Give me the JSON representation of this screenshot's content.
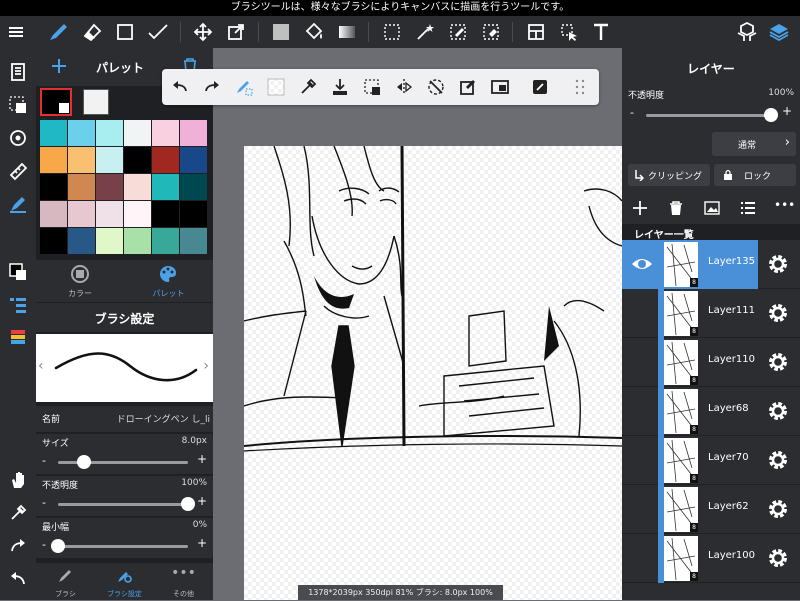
{
  "status_bar": {
    "message": "ブラシツールは、様々なブラシによりキャンバスに描画を行うツールです。"
  },
  "palette_panel": {
    "title": "パレット",
    "tabs": [
      {
        "label": "カラー"
      },
      {
        "label": "パレット"
      }
    ],
    "swatches": [
      "#20b8c4",
      "#6ad0ec",
      "#a8eef0",
      "#f0f4f4",
      "#f8d0e0",
      "#f0b0d8",
      "#f8a848",
      "#f8c070",
      "#c8f0f0",
      "#000000",
      "#a02820",
      "#184888",
      "#000000",
      "#d08850",
      "#784048",
      "#f8dcd8",
      "#20b8b8",
      "#004850",
      "#d8b8c0",
      "#e8c8d0",
      "#f0e0e8",
      "#fff4f8",
      "#000000",
      "#000000",
      "#000000",
      "#285888",
      "#e0f8c8",
      "#a8e0a8",
      "#38a898",
      "#488890"
    ]
  },
  "brush_settings": {
    "title": "ブラシ設定",
    "name_label": "名前",
    "name_value": "ドローイングペン し_li",
    "size_label": "サイズ",
    "size_value": "8.0px",
    "size_fraction": 0.2,
    "opacity_label": "不透明度",
    "opacity_value": "100%",
    "opacity_fraction": 1.0,
    "min_width_label": "最小幅",
    "min_width_value": "0%",
    "min_width_fraction": 0.0
  },
  "bottom_tabs": [
    {
      "label": "ブラシ"
    },
    {
      "label": "ブラシ設定"
    },
    {
      "label": "その他"
    }
  ],
  "layer_panel": {
    "title": "レイヤー",
    "opacity_label": "不透明度",
    "opacity_value": "100%",
    "blend_mode": "通常",
    "clipping_label": "クリッピング",
    "lock_label": "ロック",
    "list_title": "レイヤー一覧",
    "layers": [
      {
        "name": "Layer135",
        "selected": true
      },
      {
        "name": "Layer111",
        "selected": false
      },
      {
        "name": "Layer110",
        "selected": false
      },
      {
        "name": "Layer68",
        "selected": false
      },
      {
        "name": "Layer70",
        "selected": false
      },
      {
        "name": "Layer62",
        "selected": false
      },
      {
        "name": "Layer100",
        "selected": false
      }
    ]
  },
  "canvas_info": "1378*2039px 350dpi 81% ブラシ: 8.0px 100%",
  "colors": {
    "accent": "#4aa3e8",
    "selected_layer": "#4a90d9"
  }
}
